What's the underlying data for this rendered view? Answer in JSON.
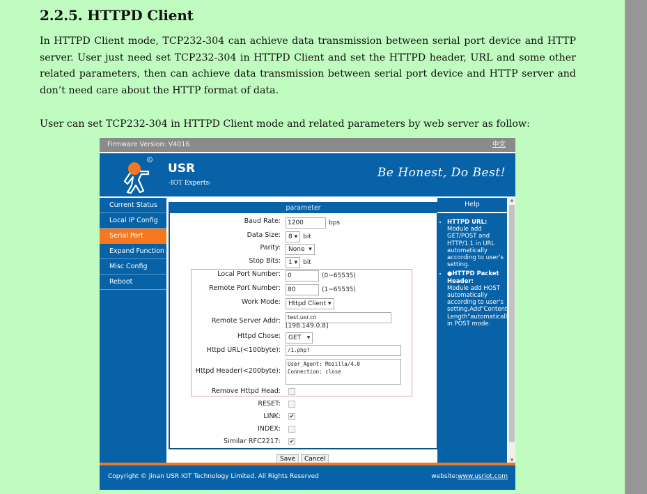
{
  "document": {
    "heading": "2.2.5. HTTPD Client",
    "paragraph1": "In HTTPD Client mode, TCP232-304 can achieve data transmission between serial port device and HTTP server. User just need set TCP232-304 in HTTPD Client and set the HTTPD header, URL and some other related parameters, then can achieve data transmission between serial port device and HTTP server and don’t need care about the HTTP format of data.",
    "paragraph2": "User can set TCP232-304 in HTTPD Client mode and related parameters by web server as follow:"
  },
  "web_ui": {
    "firmware_version": "Firmware Version:  V4016",
    "language_link": "中文",
    "brand": "USR",
    "brand_tagline": "-IOT Experts-",
    "slogan": "Be Honest, Do Best!",
    "colors": {
      "primary": "#0762a8",
      "accent": "#f5781e",
      "background": "#c0fcc0"
    },
    "sidebar": {
      "items": [
        {
          "label": "Current Status"
        },
        {
          "label": "Local IP Config"
        },
        {
          "label": "Serial Port",
          "active": true
        },
        {
          "label": "Expand Function"
        },
        {
          "label": "Misc Config"
        },
        {
          "label": "Reboot"
        }
      ]
    },
    "panel_title": "parameter",
    "form": {
      "baud_rate": {
        "label": "Baud Rate:",
        "value": "1200",
        "unit": "bps"
      },
      "data_size": {
        "label": "Data Size:",
        "value": "8",
        "unit": "bit"
      },
      "parity": {
        "label": "Parity:",
        "value": "None"
      },
      "stop_bits": {
        "label": "Stop Bits:",
        "value": "1",
        "unit": "bit"
      },
      "local_port": {
        "label": "Local Port Number:",
        "value": "0",
        "hint": "(0~65535)"
      },
      "remote_port": {
        "label": "Remote Port Number:",
        "value": "80",
        "hint": "(1~65535)"
      },
      "work_mode": {
        "label": "Work Mode:",
        "value": "Httpd Client"
      },
      "remote_server": {
        "label": "Remote Server Addr:",
        "value": "test.usr.cn",
        "resolved": "[198.149.0.8]"
      },
      "httpd_chose": {
        "label": "Httpd Chose:",
        "value": "GET"
      },
      "httpd_url": {
        "label": "Httpd URL(<100byte):",
        "value": "/1.php?"
      },
      "httpd_header": {
        "label": "Httpd Header(<200byte):",
        "line1": "User_Agent: Mozilla/4.0",
        "line2": "Connection: close"
      },
      "remove_head": {
        "label": "Remove Httpd Head:",
        "checked": false
      },
      "reset": {
        "label": "RESET:",
        "checked": false
      },
      "link": {
        "label": "LINK:",
        "checked": true
      },
      "index": {
        "label": "INDEX:",
        "checked": false
      },
      "rfc2217": {
        "label": "Similar RFC2217:",
        "checked": true
      }
    },
    "buttons": {
      "save": "Save",
      "cancel": "Cancel"
    },
    "help": {
      "title": "Help",
      "items": [
        {
          "title": "HTTPD URL:",
          "text": "Module add GET/POST and HTTP/1.1 in URL automatically according to user's setting."
        },
        {
          "title": "●HTTPD Packet Header:",
          "text": "Module add HOST automatically according to user's setting.Add\"Content-Length\"automatically in POST mode."
        }
      ]
    },
    "footer": {
      "copyright": "Copyright © Jinan USR IOT Technology Limited. All Rights Reserved",
      "website_label": "website:",
      "website_url": "www.usriot.com"
    }
  }
}
